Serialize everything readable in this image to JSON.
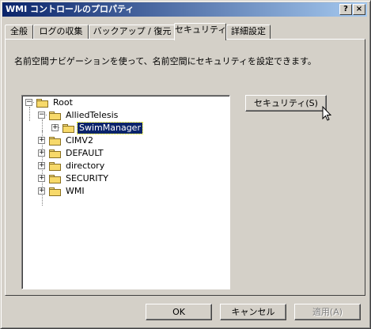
{
  "window": {
    "title": "WMI コントロールのプロパティ",
    "help_label": "?",
    "close_label": "×"
  },
  "tabs": [
    {
      "label": "全般"
    },
    {
      "label": "ログの収集"
    },
    {
      "label": "バックアップ / 復元"
    },
    {
      "label": "セキュリティ"
    },
    {
      "label": "詳細設定"
    }
  ],
  "active_tab": "セキュリティ",
  "description": "名前空間ナビゲーションを使って、名前空間にセキュリティを設定できます。",
  "tree": {
    "root": "Root",
    "allied": "AlliedTelesis",
    "swim": "SwimManager",
    "cimv2": "CIMV2",
    "default": "DEFAULT",
    "directory": "directory",
    "security": "SECURITY",
    "wmi": "WMI",
    "selected": "SwimManager"
  },
  "buttons": {
    "security": "セキュリティ(S)",
    "ok": "OK",
    "cancel": "キャンセル",
    "apply": "適用(A)"
  },
  "colors": {
    "titlebar_start": "#0a246a",
    "titlebar_end": "#a6caf0",
    "selection": "#0a246a",
    "face": "#d4d0c8"
  }
}
